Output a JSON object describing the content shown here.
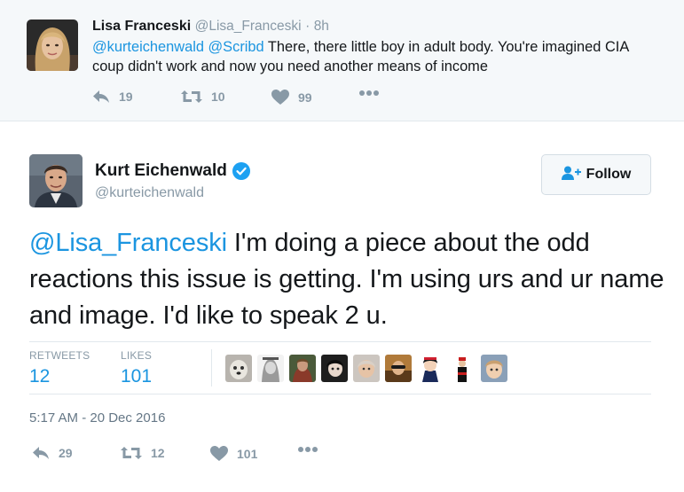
{
  "parent_tweet": {
    "name": "Lisa Franceski",
    "handle": "@Lisa_Franceski",
    "separator": "·",
    "time": "8h",
    "mention_1": "@kurteichenwald",
    "mention_2": "@Scribd",
    "body": " There, there little boy in adult body. You're imagined CIA coup didn't work and now you need another means of income",
    "reply_count": "19",
    "retweet_count": "10",
    "like_count": "99"
  },
  "main_tweet": {
    "name": "Kurt Eichenwald",
    "handle": "@kurteichenwald",
    "follow_label": "Follow",
    "mention": "@Lisa_Franceski",
    "body": " I'm doing a piece about the odd reactions this issue is getting. I'm using urs and ur name and image. I'd like to speak 2 u.",
    "retweets_label": "RETWEETS",
    "retweets_value": "12",
    "likes_label": "LIKES",
    "likes_value": "101",
    "timestamp": "5:17 AM - 20 Dec 2016",
    "reply_count": "29",
    "retweet_count": "12",
    "like_count": "101"
  },
  "icons": {
    "reply": "reply-icon",
    "retweet": "retweet-icon",
    "like": "heart-icon",
    "more": "more-dots-icon",
    "verified": "verified-badge-icon",
    "follow": "add-person-icon"
  },
  "colors": {
    "accent": "#1b95e0",
    "muted": "#8899a6",
    "parent_background": "#f5f8fa",
    "verified": "#1da1f2"
  }
}
